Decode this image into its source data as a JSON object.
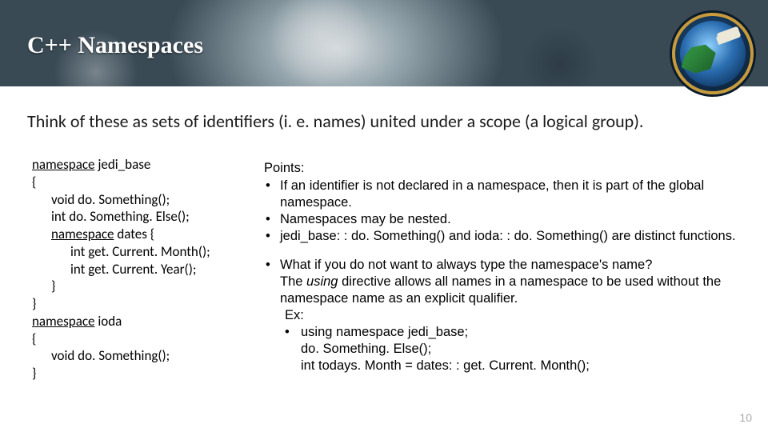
{
  "title": "C++ Namespaces",
  "intro": "Think of these as sets of identifiers (i. e. names) united under a scope (a logical group).",
  "code": {
    "l1a": "namespace",
    "l1b": " jedi_base",
    "l2": "{",
    "l3": "void do. Something();",
    "l4": "int do. Something. Else();",
    "l5a": "namespace",
    "l5b": " dates {",
    "l6": "int get. Current. Month();",
    "l7": "int get. Current. Year();",
    "l8": "}",
    "l9": "}",
    "l10a": "namespace",
    "l10b": " ioda",
    "l11": "{",
    "l12": "void do. Something();",
    "l13": "}"
  },
  "points": {
    "hdr": "Points:",
    "b1": "If an identifier is not declared in a namespace, then it is part of the global namespace.",
    "b2": "Namespaces may be nested.",
    "b3": "jedi_base: : do. Something() and ioda: : do. Something() are distinct functions.",
    "b4a": "What if you do not want to always type the namespace's name?",
    "b4b_pre": "The ",
    "b4b_em": "using",
    "b4b_post": " directive allows all names in a namespace to be used without the namespace name as an explicit qualifier.",
    "ex_label": "Ex:",
    "s1": "using namespace jedi_base;",
    "s2": "do. Something. Else();",
    "s3": "int todays. Month = dates: : get. Current. Month();"
  },
  "pagenum": "10",
  "logo_name": "jcsda-logo"
}
